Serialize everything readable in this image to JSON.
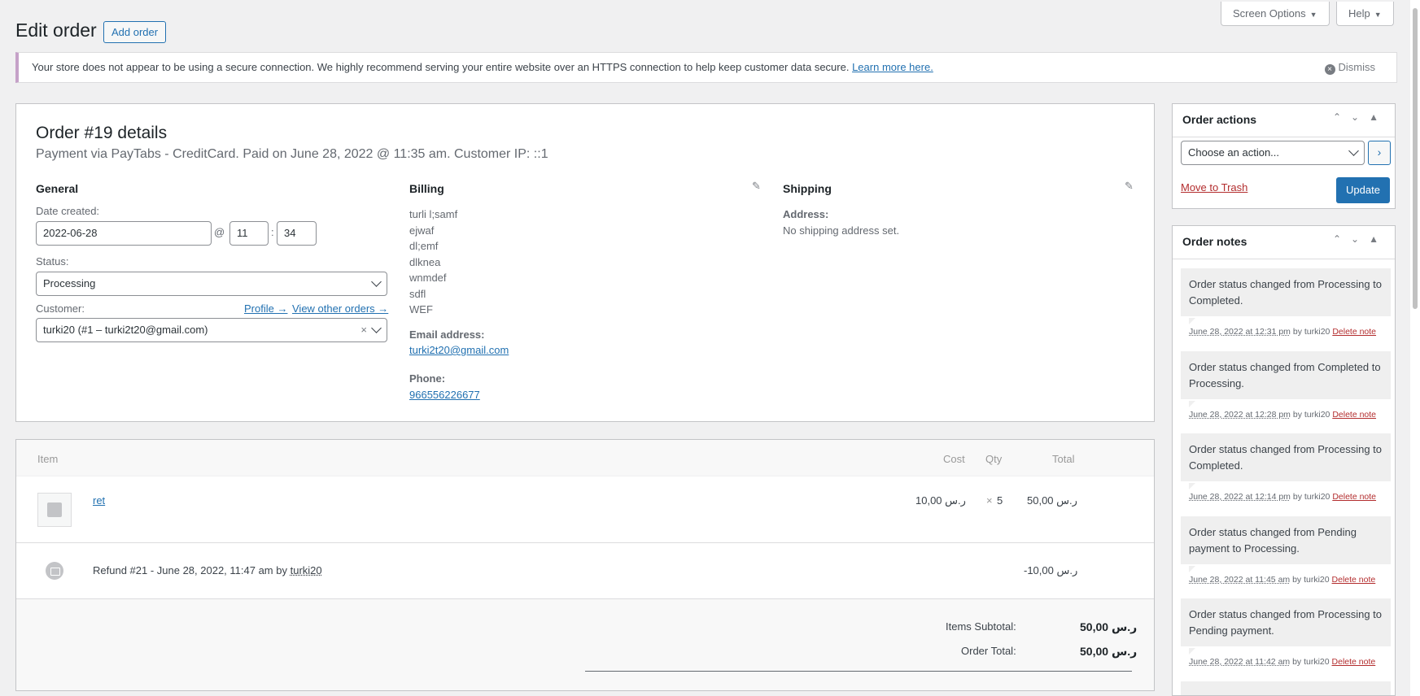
{
  "header": {
    "title": "Edit order",
    "add_order": "Add order",
    "screen_options": "Screen Options",
    "help": "Help"
  },
  "notice": {
    "text": "Your store does not appear to be using a secure connection. We highly recommend serving your entire website over an HTTPS connection to help keep customer data secure.",
    "link": "Learn more here.",
    "dismiss": "Dismiss"
  },
  "order": {
    "heading": "Order #19 details",
    "subheading": "Payment via PayTabs - CreditCard. Paid on June 28, 2022 @ 11:35 am. Customer IP: ::1",
    "general": {
      "title": "General",
      "date_label": "Date created:",
      "date": "2022-06-28",
      "at": "@",
      "hour": "11",
      "colon": ":",
      "minute": "34",
      "status_label": "Status:",
      "status": "Processing",
      "customer_label": "Customer:",
      "profile_link": "Profile →",
      "other_orders_link": "View other orders →",
      "customer": "turki20 (#1 – turki2t20@gmail.com)",
      "clear": "×"
    },
    "billing": {
      "title": "Billing",
      "address_lines": [
        "turli l;samf",
        "ejwaf",
        "dl;emf",
        "dlknea",
        "wnmdef",
        "sdfl",
        "WEF"
      ],
      "email_label": "Email address:",
      "email": "turki2t20@gmail.com",
      "phone_label": "Phone:",
      "phone": "966556226677"
    },
    "shipping": {
      "title": "Shipping",
      "address_label": "Address:",
      "address": "No shipping address set."
    }
  },
  "items": {
    "headers": {
      "item": "Item",
      "cost": "Cost",
      "qty": "Qty",
      "total": "Total"
    },
    "rows": [
      {
        "name": "ret",
        "cost": "10,00 ر.س",
        "qty_x": "×",
        "qty": "5",
        "total": "50,00 ر.س"
      }
    ],
    "refund": {
      "text_prefix": "Refund #21 - June 28, 2022, 11:47 am by",
      "user": "turki20",
      "amount": "-10,00 ر.س"
    },
    "totals": [
      {
        "label": "Items Subtotal:",
        "value": "50,00 ر.س"
      },
      {
        "label": "Order Total:",
        "value": "50,00 ر.س"
      }
    ]
  },
  "order_actions": {
    "title": "Order actions",
    "select": "Choose an action...",
    "go": "›",
    "trash": "Move to Trash",
    "update": "Update"
  },
  "order_notes": {
    "title": "Order notes",
    "by": "by turki20",
    "delete": "Delete note",
    "notes": [
      {
        "text": "Order status changed from Processing to Completed.",
        "date": "June 28, 2022 at 12:31 pm"
      },
      {
        "text": "Order status changed from Completed to Processing.",
        "date": "June 28, 2022 at 12:28 pm"
      },
      {
        "text": "Order status changed from Processing to Completed.",
        "date": "June 28, 2022 at 12:14 pm"
      },
      {
        "text": "Order status changed from Pending payment to Processing.",
        "date": "June 28, 2022 at 11:45 am"
      },
      {
        "text": "Order status changed from Processing to Pending payment.",
        "date": "June 28, 2022 at 11:42 am"
      }
    ]
  },
  "colors": {
    "accent": "#2271b1",
    "danger": "#b32d2e",
    "notice_border": "#c5a1c8"
  }
}
